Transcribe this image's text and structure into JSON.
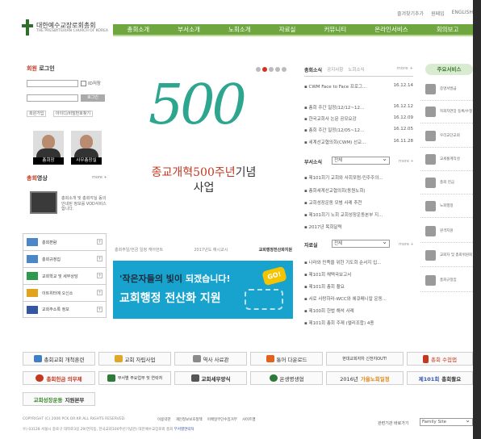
{
  "util": {
    "items": [
      "즐겨찾기추가",
      "원페입",
      "ENGLISH"
    ]
  },
  "logo": {
    "name_ko": "대한예수교장로회총회",
    "name_en": "THE PRESBYTERIAN CHURCH OF KOREA"
  },
  "gnb": [
    "총회소개",
    "부서소개",
    "노회소개",
    "자료실",
    "커뮤니티",
    "온라인서비스",
    "회의보고"
  ],
  "login": {
    "title_prefix": "회원",
    "title": "로그인",
    "save_id": "ID저장",
    "login_btn": "로그인",
    "join": "회원가입",
    "find": "아이디/비밀번호찾기"
  },
  "people": [
    {
      "caption": "총회장"
    },
    {
      "caption": "사무총장실"
    }
  ],
  "video": {
    "title_prefix": "총회",
    "title": "영상",
    "more": "more +",
    "desc": "총회소개 및 총회각실 동의 안내된 정보를 VOD서비스합니다."
  },
  "quick": [
    "총회편람",
    "총회규정집",
    "교회학교 및 세무상담",
    "이트위터에 오신소",
    "교회주소록 정보"
  ],
  "hero": {
    "number": "500",
    "line1_prefix": "종교개혁500주년",
    "line1_suffix": "기념",
    "line2": "사업"
  },
  "mid_tabs": [
    "총회주일/헌금 일정 캐어먼트",
    "2017년도 예시교시",
    "교회행정전산화지원"
  ],
  "campaign": {
    "line1_a": "'작은자들의 빛이",
    "line1_b": " 되겠습니다!",
    "line2": "교회행정 전산화 지원",
    "badge": "GO!"
  },
  "news": {
    "title": "총회소식",
    "tabs": [
      "공지사항",
      "노회소식"
    ],
    "more": "more +",
    "items": [
      {
        "t": "CWM Face to Face 프로그...",
        "d": "16.12.14"
      },
      {
        "t": "총회 주간 일정(12/12~12...",
        "d": "16.12.12"
      },
      {
        "t": "한국교회사 논문 공모요강",
        "d": "16.12.09"
      },
      {
        "t": "총회 주간 일정(12/05~12...",
        "d": "16.12.05"
      },
      {
        "t": "세계선교협의회(CWM) 선교...",
        "d": "16.11.28"
      }
    ]
  },
  "dept": {
    "title": "부서소식",
    "select": "전체",
    "more": "more +",
    "items": [
      "제101회기 교회와 사회포럼-민주주의...",
      "총회세계선교협의회(동원노회)",
      "교회성장운동 모범 사례 추천",
      "제101회기 노회 교회성장운동본부 지...",
      "2017년 목회달력"
    ]
  },
  "archive": {
    "title": "자료실",
    "select": "전체",
    "more": "more +",
    "items": [
      "나라와 민족을 위한 기도회 순서지 입...",
      "제101회 채택국보고서",
      "제101회 총회 촬요",
      "서로 사랑하라-WCC와 에큐메니칼 운동...",
      "제100회 헌법 해석 사례",
      "제101회 총회 주제 (엘리조합) 4종"
    ]
  },
  "services": {
    "title": "주요서비스",
    "items": [
      "증명서발급",
      "목회자연장 등록/수정",
      "우리교단교회",
      "교세통계작성",
      "총회 헌금",
      "노회행정",
      "원격지원",
      "교회자 및 총회위원회",
      "총회규정집"
    ]
  },
  "banners": {
    "row1": [
      "총회교회 개척훈련",
      "교회 자립사업",
      "역사 사료관",
      "통어 다운로드",
      "현대교회자차 신전지OUT!",
      "총회 수첩앱"
    ],
    "row2_a": [
      "총회헌금 의무제",
      "부서별 주요업무 및 연락처",
      "교회세무양식",
      "온생명생협"
    ],
    "row2_b": {
      "prefix": "2016년 ",
      "highlight": "가을노회일정"
    },
    "row2_c": {
      "prefix": "제101회",
      "suffix": "총회촬요"
    },
    "row3": {
      "prefix": "교회성장운동",
      "suffix": "지원본부"
    }
  },
  "footer": {
    "copyright": "COPYRIGHT (C) 2006 PCK.OR.KR  ALL RIGHTS RESERVED.",
    "links": [
      "이용약관",
      "개인정보보호정책",
      "이메일무단수집거부",
      "사이트맵"
    ],
    "address": "우) 03128  서울시 종로구 대학로3길 29(연지동, 한국교회100주년기념관) 대한예수교장로회 총회",
    "address_link": "부서별연락처",
    "family_label": "관련기관 바로가기",
    "family_select": "Family Site"
  },
  "colors": {
    "nav_green": "#6fa63f",
    "accent_red": "#c5371f",
    "campaign_blue": "#18a3cf",
    "teal_500": "#2ea68f"
  }
}
